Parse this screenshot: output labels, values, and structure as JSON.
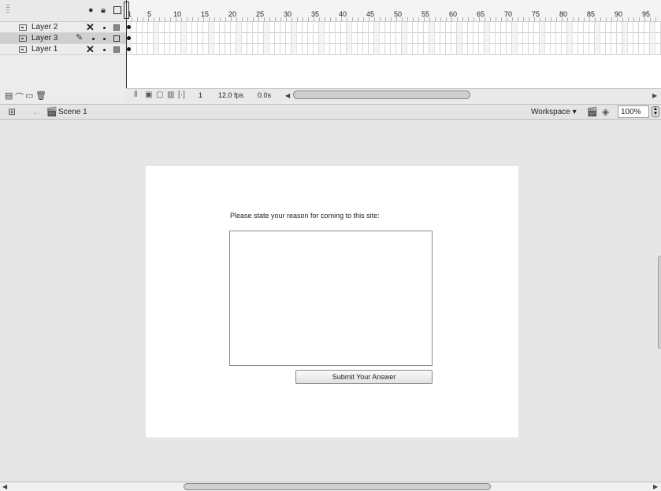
{
  "timeline": {
    "header_icons": {
      "eye": "eye-icon",
      "lock": "lock-icon",
      "outline": "outline-icon"
    },
    "ruler": [
      "1",
      "5",
      "10",
      "15",
      "20",
      "25",
      "30",
      "35",
      "40",
      "45",
      "50",
      "55",
      "60",
      "65",
      "70",
      "75",
      "80",
      "85",
      "90",
      "95"
    ],
    "layers": [
      {
        "name": "Layer 2",
        "selected": false,
        "editable": false
      },
      {
        "name": "Layer 3",
        "selected": true,
        "editable": true
      },
      {
        "name": "Layer 1",
        "selected": false,
        "editable": false
      }
    ],
    "status": {
      "current_frame": "1",
      "frame_rate": "12.0 fps",
      "elapsed_time": "0.0s"
    }
  },
  "edit_bar": {
    "scene": "Scene 1",
    "workspace": "Workspace ▾",
    "zoom": "100%"
  },
  "stage": {
    "prompt": "Please state your reason for coming to this site:",
    "answer_value": "",
    "submit_label": "Submit Your Answer"
  }
}
